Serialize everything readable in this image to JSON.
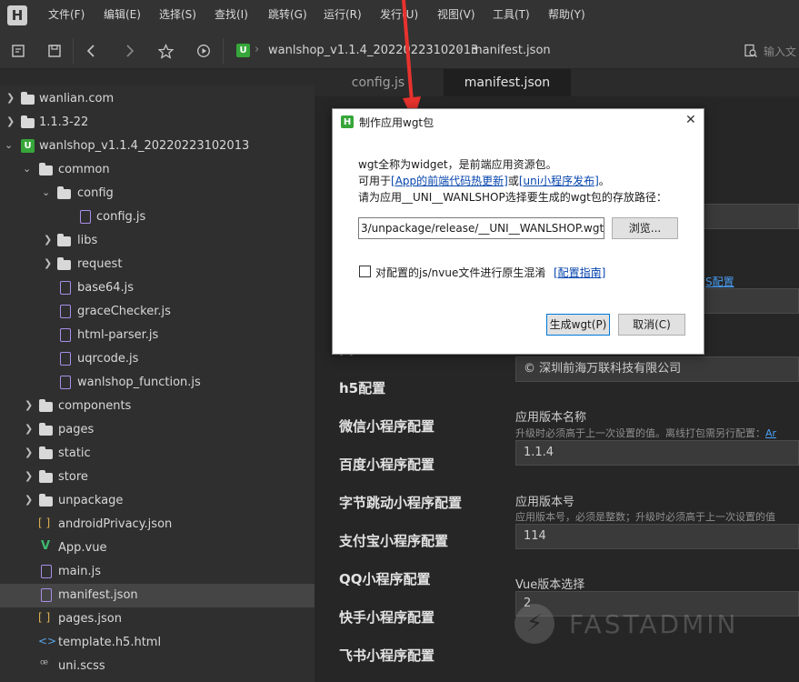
{
  "menubar": {
    "items": [
      "文件(F)",
      "编辑(E)",
      "选择(S)",
      "查找(I)",
      "跳转(G)",
      "运行(R)",
      "发行(U)",
      "视图(V)",
      "工具(T)",
      "帮助(Y)"
    ]
  },
  "app_logo": "H",
  "breadcrumb": {
    "project": "wanlshop_v1.1.4_20220223102013",
    "file": "manifest.json",
    "search_placeholder": "输入文"
  },
  "sidebar": {
    "rows": [
      {
        "label": "wanlian.com"
      },
      {
        "label": "1.1.3-22"
      },
      {
        "label": "wanlshop_v1.1.4_20220223102013"
      },
      {
        "label": "common"
      },
      {
        "label": "config"
      },
      {
        "label": "config.js"
      },
      {
        "label": "libs"
      },
      {
        "label": "request"
      },
      {
        "label": "base64.js"
      },
      {
        "label": "graceChecker.js"
      },
      {
        "label": "html-parser.js"
      },
      {
        "label": "uqrcode.js"
      },
      {
        "label": "wanlshop_function.js"
      },
      {
        "label": "components"
      },
      {
        "label": "pages"
      },
      {
        "label": "static"
      },
      {
        "label": "store"
      },
      {
        "label": "unpackage"
      },
      {
        "label": "androidPrivacy.json"
      },
      {
        "label": "App.vue"
      },
      {
        "label": "main.js"
      },
      {
        "label": "manifest.json"
      },
      {
        "label": "pages.json"
      },
      {
        "label": "template.h5.html"
      },
      {
        "label": "uni.scss"
      }
    ]
  },
  "tabs": [
    {
      "label": "config.js"
    },
    {
      "label": "manifest.json"
    }
  ],
  "editor": {
    "nav": [
      "h5配置",
      "微信小程序配置",
      "百度小程序配置",
      "字节跳动小程序配置",
      "支付宝小程序配置",
      "QQ小程序配置",
      "快手小程序配置",
      "飞书小程序配置"
    ],
    "nav_partial": "pp",
    "ios_link": "S配置",
    "copyright_value": "© 深圳前海万联科技有限公司",
    "version_name_label": "应用版本名称",
    "version_name_hint": "升级时必须高于上一次设置的值。离线打包需另行配置：",
    "version_name_hint_link": "Ar",
    "version_name_value": "1.1.4",
    "version_code_label": "应用版本号",
    "version_code_hint": "应用版本号，必须是整数；升级时必须高于上一次设置的值",
    "version_code_value": "114",
    "vue_label": "Vue版本选择",
    "vue_value": "2"
  },
  "watermark": "FASTADMIN",
  "dialog": {
    "icon": "H",
    "title": "制作应用wgt包",
    "close": "✕",
    "line1": "wgt全称为widget，是前端应用资源包。",
    "line2_prefix": "可用于",
    "line2_link1": "[App的前端代码热更新]",
    "line2_mid": "或",
    "line2_link2": "[uni小程序发布]",
    "line2_suffix": "。",
    "line3": "请为应用__UNI__WANLSHOP选择要生成的wgt包的存放路径：",
    "path_value": "3/unpackage/release/__UNI__WANLSHOP.wgt",
    "browse_label": "浏览...",
    "checkbox_label": "对配置的js/nvue文件进行原生混淆",
    "guide_link": "[配置指南]",
    "generate_label": "生成wgt(P)",
    "cancel_label": "取消(C)"
  }
}
